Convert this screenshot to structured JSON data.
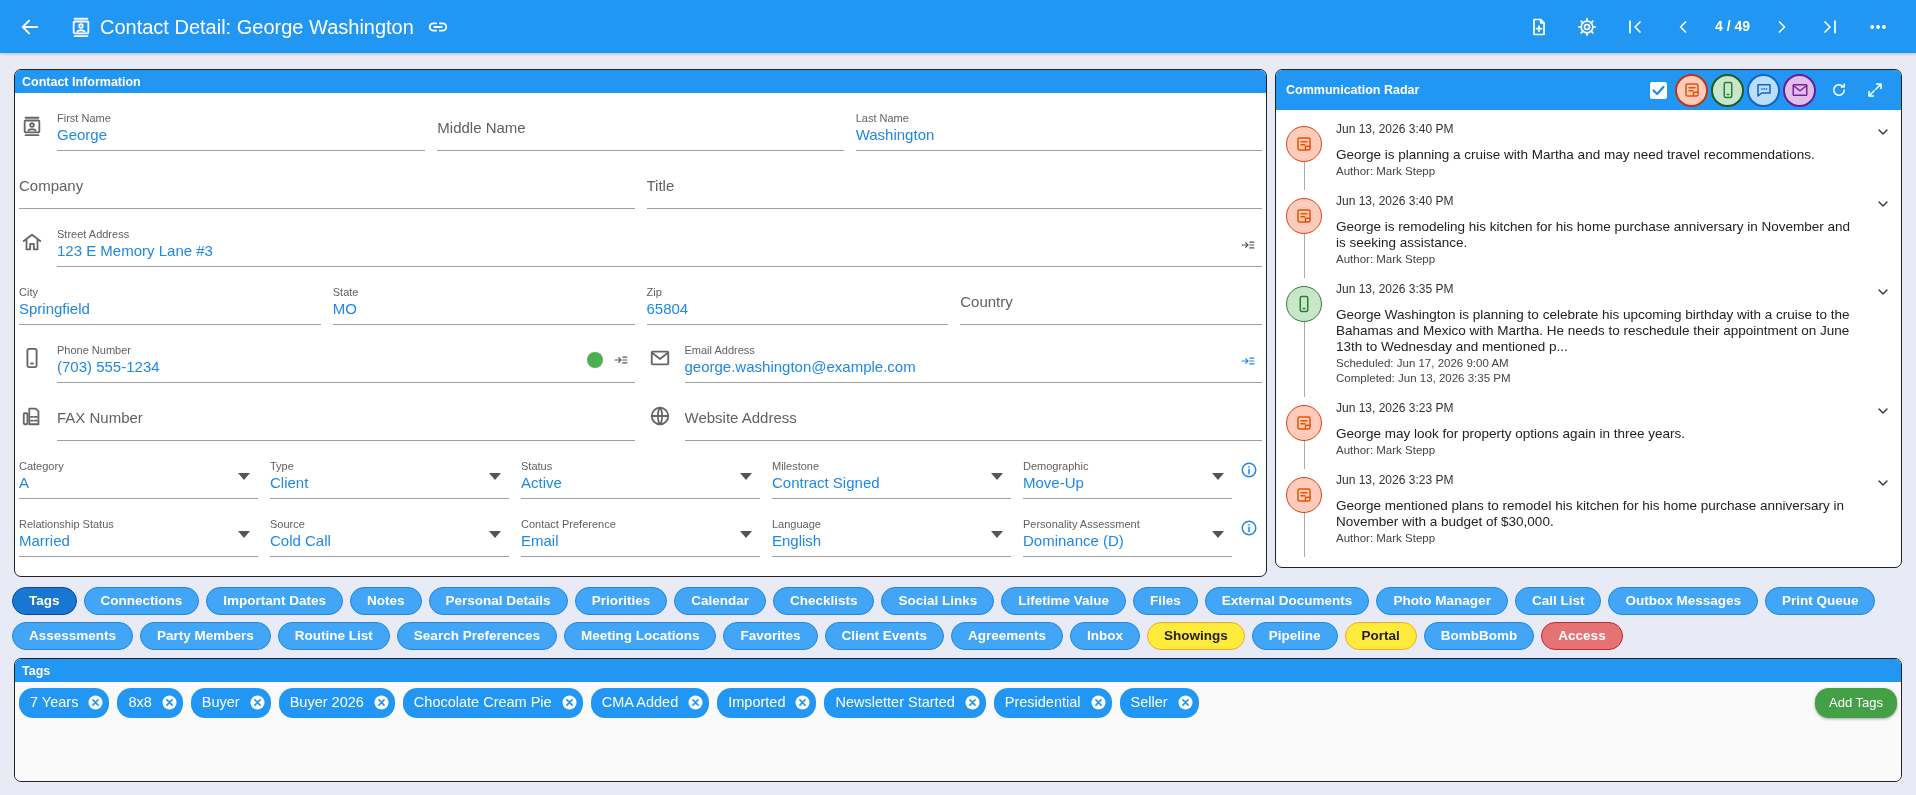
{
  "top_bar": {
    "title": "Contact Detail: George Washington",
    "pager": "4 / 49"
  },
  "contact_information": {
    "title": "Contact Information",
    "rows": [
      [
        {
          "kind": "person",
          "label": "First Name",
          "value": "George"
        },
        {
          "kind": "plain",
          "placeholder": "Middle Name"
        },
        {
          "kind": "plain",
          "label": "Last Name",
          "value": "Washington"
        }
      ],
      [
        {
          "kind": "plain",
          "placeholder": "Company"
        },
        {
          "kind": "plain",
          "placeholder": "Title"
        }
      ],
      [
        {
          "kind": "address",
          "label": "Street Address",
          "value": "123 E Memory Lane #3",
          "highlighted": false
        }
      ],
      [
        {
          "kind": "plain",
          "label": "City",
          "value": "Springfield"
        },
        {
          "kind": "plain",
          "label": "State",
          "value": "MO"
        },
        {
          "kind": "plain",
          "label": "Zip",
          "value": "65804"
        },
        {
          "kind": "plain",
          "placeholder": "Country"
        }
      ],
      [
        {
          "kind": "phone",
          "label": "Phone Number",
          "value": "(703) 555-1234",
          "color": "#4caf50",
          "highlighted": false
        },
        {
          "kind": "email",
          "label": "Email Address",
          "value": "george.washington@example.com",
          "highlighted": true
        }
      ],
      [
        {
          "kind": "fax",
          "placeholder": "FAX Number"
        },
        {
          "kind": "web",
          "placeholder": "Website Address"
        }
      ],
      [
        {
          "kind": "select",
          "label": "Category",
          "value": "A"
        },
        {
          "kind": "select",
          "label": "Type",
          "value": "Client"
        },
        {
          "kind": "select",
          "label": "Status",
          "value": "Active"
        },
        {
          "kind": "select",
          "label": "Milestone",
          "value": "Contract Signed"
        },
        {
          "kind": "select",
          "label": "Demographic",
          "value": "Move-Up",
          "info": true
        }
      ],
      [
        {
          "kind": "select",
          "label": "Relationship Status",
          "value": "Married"
        },
        {
          "kind": "select",
          "label": "Source",
          "value": "Cold Call"
        },
        {
          "kind": "select",
          "label": "Contact Preference",
          "value": "Email"
        },
        {
          "kind": "select",
          "label": "Language",
          "value": "English"
        },
        {
          "kind": "select",
          "label": "Personality Assessment",
          "value": "Dominance (D)",
          "info": true
        }
      ]
    ]
  },
  "communication_radar": {
    "title": "Communication Radar",
    "show_completed": {
      "checked": true
    },
    "filters": [
      {
        "kind": "note",
        "color": "#ffccbc"
      },
      {
        "kind": "call",
        "color": "#c8e6c9"
      },
      {
        "kind": "text",
        "color": "#bbdefb"
      },
      {
        "kind": "email",
        "color": "#e1bee7"
      }
    ],
    "entries": [
      {
        "kind": "note",
        "date": "Jun 13, 2026 3:40 PM",
        "text": "George is planning a cruise with Martha and may need travel recommendations.",
        "details": [
          "Author: Mark Stepp"
        ]
      },
      {
        "kind": "note",
        "date": "Jun 13, 2026 3:40 PM",
        "text": "George is remodeling his kitchen for his home purchase anniversary in November and is seeking assistance.",
        "details": [
          "Author: Mark Stepp"
        ]
      },
      {
        "kind": "call",
        "date": "Jun 13, 2026 3:35 PM",
        "text": "George Washington is planning to celebrate his upcoming birthday with a cruise to the Bahamas and Mexico with Martha. He needs to reschedule their appointment on June 13th to Wednesday and mentioned p...",
        "details": [
          "Scheduled: Jun 17, 2026 9:00 AM",
          "Completed: Jun 13, 2026 3:35 PM"
        ]
      },
      {
        "kind": "note",
        "date": "Jun 13, 2026 3:23 PM",
        "text": "George may look for property options again in three years.",
        "details": [
          "Author: Mark Stepp"
        ]
      },
      {
        "kind": "note",
        "date": "Jun 13, 2026 3:23 PM",
        "text": "George mentioned plans to remodel his kitchen for his home purchase anniversary in November with a budget of $30,000.",
        "details": [
          "Author: Mark Stepp"
        ]
      }
    ]
  },
  "section_buttons": [
    [
      {
        "label": "Tags",
        "kind": "default",
        "selected": true
      },
      {
        "label": "Connections",
        "kind": "default",
        "selected": false
      },
      {
        "label": "Important Dates",
        "kind": "default",
        "selected": false
      },
      {
        "label": "Notes",
        "kind": "default",
        "selected": false
      },
      {
        "label": "Personal Details",
        "kind": "default",
        "selected": false
      },
      {
        "label": "Priorities",
        "kind": "default",
        "selected": false
      },
      {
        "label": "Calendar",
        "kind": "default",
        "selected": false
      },
      {
        "label": "Checklists",
        "kind": "default",
        "selected": false
      },
      {
        "label": "Social Links",
        "kind": "default",
        "selected": false
      },
      {
        "label": "Lifetime Value",
        "kind": "default",
        "selected": false
      },
      {
        "label": "Files",
        "kind": "default",
        "selected": false
      },
      {
        "label": "External Documents",
        "kind": "default",
        "selected": false
      },
      {
        "label": "Photo Manager",
        "kind": "default",
        "selected": false
      },
      {
        "label": "Call List",
        "kind": "default",
        "selected": false
      },
      {
        "label": "Outbox Messages",
        "kind": "default",
        "selected": false
      },
      {
        "label": "Print Queue",
        "kind": "default",
        "selected": false
      }
    ],
    [
      {
        "label": "Assessments",
        "kind": "default",
        "selected": false
      },
      {
        "label": "Party Members",
        "kind": "default",
        "selected": false
      },
      {
        "label": "Routine List",
        "kind": "default",
        "selected": false
      },
      {
        "label": "Search Preferences",
        "kind": "default",
        "selected": false
      },
      {
        "label": "Meeting Locations",
        "kind": "default",
        "selected": false
      },
      {
        "label": "Favorites",
        "kind": "default",
        "selected": false
      },
      {
        "label": "Client Events",
        "kind": "default",
        "selected": false
      },
      {
        "label": "Agreements",
        "kind": "default",
        "selected": false
      },
      {
        "label": "Inbox",
        "kind": "default",
        "selected": false
      },
      {
        "label": "Showings",
        "kind": "warning",
        "selected": false
      },
      {
        "label": "Pipeline",
        "kind": "default",
        "selected": false
      },
      {
        "label": "Portal",
        "kind": "warning",
        "selected": false
      },
      {
        "label": "BombBomb",
        "kind": "default",
        "selected": false
      },
      {
        "label": "Access",
        "kind": "danger",
        "selected": false
      }
    ]
  ],
  "tags_panel": {
    "title": "Tags",
    "tags": [
      "7 Years",
      "8x8",
      "Buyer",
      "Buyer 2026",
      "Chocolate Cream Pie",
      "CMA Added",
      "Imported",
      "Newsletter Started",
      "Presidential",
      "Seller"
    ],
    "add_button": "Add Tags"
  }
}
